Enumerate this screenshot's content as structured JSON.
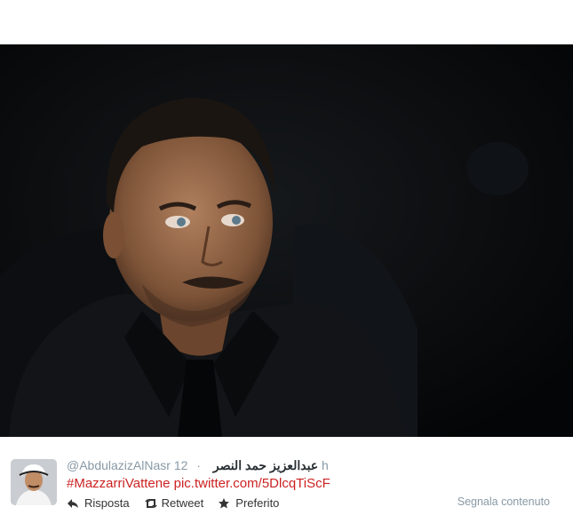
{
  "tweet": {
    "handle": "@AbdulazizAlNasr",
    "display_name": "عبدالعزيز حمد النصر",
    "separator": "·",
    "time": "12 h",
    "hashtag": "#MazzarriVattene",
    "link": "pic.twitter.com/5DlcqTiScF"
  },
  "actions": {
    "reply_label": "Risposta",
    "retweet_label": "Retweet",
    "favorite_label": "Preferito",
    "report_label": "Segnala contenuto"
  },
  "icons": {
    "reply": "reply-arrow-icon",
    "retweet": "retweet-icon",
    "favorite": "star-icon"
  },
  "colors": {
    "hashtag": "#cc2222",
    "meta": "#8899a6",
    "photo_bg": "#070809"
  }
}
